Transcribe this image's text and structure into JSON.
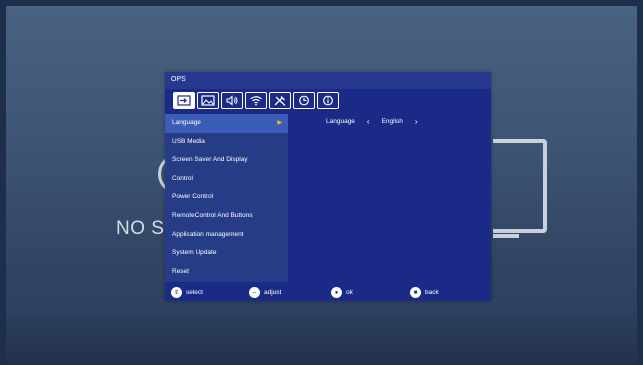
{
  "background": {
    "no_signal_text": "NO S",
    "colors": {
      "screen": "#3f5676",
      "osd_panel": "#1b2a87",
      "menu_highlight": "#3b5db8",
      "arrow": "#f5c400"
    }
  },
  "osd": {
    "title": "OPS",
    "tabs": [
      {
        "icon": "input-source-icon"
      },
      {
        "icon": "picture-icon"
      },
      {
        "icon": "sound-icon"
      },
      {
        "icon": "wifi-icon"
      },
      {
        "icon": "tools-icon"
      },
      {
        "icon": "timer-icon"
      },
      {
        "icon": "info-icon"
      }
    ],
    "menu": {
      "items": [
        {
          "label": "Language",
          "selected": true
        },
        {
          "label": "USB Media"
        },
        {
          "label": "Screen Saver And Display"
        },
        {
          "label": "Control"
        },
        {
          "label": "Power Control"
        },
        {
          "label": "RemoteControl And Buttons"
        },
        {
          "label": "Application management"
        },
        {
          "label": "System Update"
        },
        {
          "label": "Reset"
        }
      ]
    },
    "detail": {
      "label": "Language",
      "value": "English"
    },
    "footer": {
      "select": "select",
      "adjust": "adjust",
      "ok": "ok",
      "back": "back"
    }
  }
}
